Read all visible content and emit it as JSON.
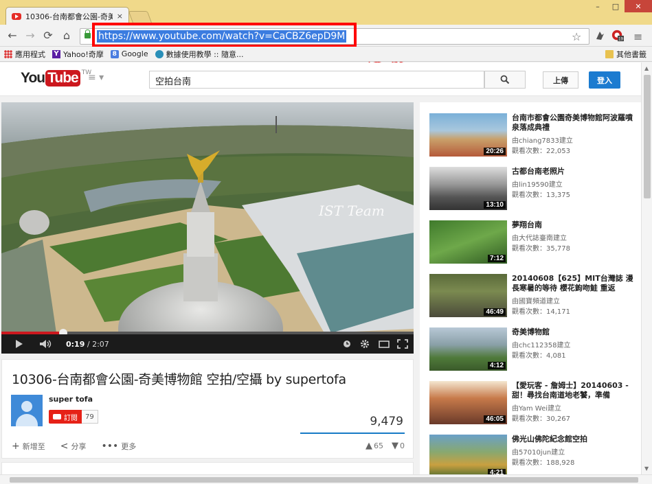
{
  "browser": {
    "tab_title": "10306-台南都會公園-奇美",
    "tab_close": "×",
    "url": "https://www.youtube.com/watch?v=CaCBZ6epD9M",
    "annotation": "複製",
    "min_symbol": "–",
    "max_symbol": "□",
    "close_symbol": "✕",
    "back_symbol": "←",
    "forward_symbol": "→",
    "reload_symbol": "⟳",
    "home_symbol": "⌂",
    "star_symbol": "☆",
    "menu_symbol": "≡",
    "extension_badge": "19"
  },
  "bookmarks": {
    "items": [
      "應用程式",
      "Yahoo!奇摩",
      "Google",
      "數據使用教學 :: 隨意..."
    ],
    "other": "其他書籤"
  },
  "youtube": {
    "logo_you": "You",
    "logo_tube": "Tube",
    "logo_region": "TW",
    "guide_symbol": "≡ ▾",
    "search_query": "空拍台南",
    "search_icon": "🔍",
    "upload_label": "上傳",
    "signin_label": "登入"
  },
  "player": {
    "current_time": "0:19",
    "duration": "/ 2:07",
    "progress": 0.15,
    "watermark": "IST Team"
  },
  "video": {
    "title": "10306-台南都會公園-奇美博物館 空拍/空攝 by supertofa",
    "channel": "super tofa",
    "subscribe_label": "訂閱",
    "subscriber_count": "79",
    "views": "9,479",
    "add_label": "新增至",
    "share_label": "分享",
    "more_label": "更多",
    "likes": "65",
    "dislikes": "0"
  },
  "recommendations": [
    {
      "title": "台南市都會公園奇美博物館阿波羅噴泉落成典禮",
      "uploader": "由chiang7833建立",
      "views": "觀看次數：22,053",
      "duration": "20:26"
    },
    {
      "title": "古都台南老照片",
      "uploader": "由lin19590建立",
      "views": "觀看次數：13,375",
      "duration": "13:10"
    },
    {
      "title": "夢翔台南",
      "uploader": "由大代誌臺南建立",
      "views": "觀看次數：35,778",
      "duration": "7:12"
    },
    {
      "title": "20140608【625】MIT台灣誌 漫長寒暑的等待 櫻花鉤吻鮭 重返",
      "uploader": "由國寶頻道建立",
      "views": "觀看次數：14,171",
      "duration": "46:49"
    },
    {
      "title": "奇美博物館",
      "uploader": "由chc112358建立",
      "views": "觀看次數：4,081",
      "duration": "4:12"
    },
    {
      "title": "【愛玩客 - 詹姆士】20140603 - 甜！尋找台南道地老饕，準備",
      "uploader": "由Yam Wei建立",
      "views": "觀看次數：30,267",
      "duration": "46:05"
    },
    {
      "title": "佛光山佛陀紀念館空拍",
      "uploader": "由57010jun建立",
      "views": "觀看次數：188,928",
      "duration": "4:21"
    }
  ],
  "colors": {
    "chrome_frame": "#f0d98a",
    "url_highlight": "#3b7ce0",
    "annotation_red": "#ff0000",
    "youtube_red": "#cc181e",
    "signin_blue": "#1b7bd0"
  }
}
